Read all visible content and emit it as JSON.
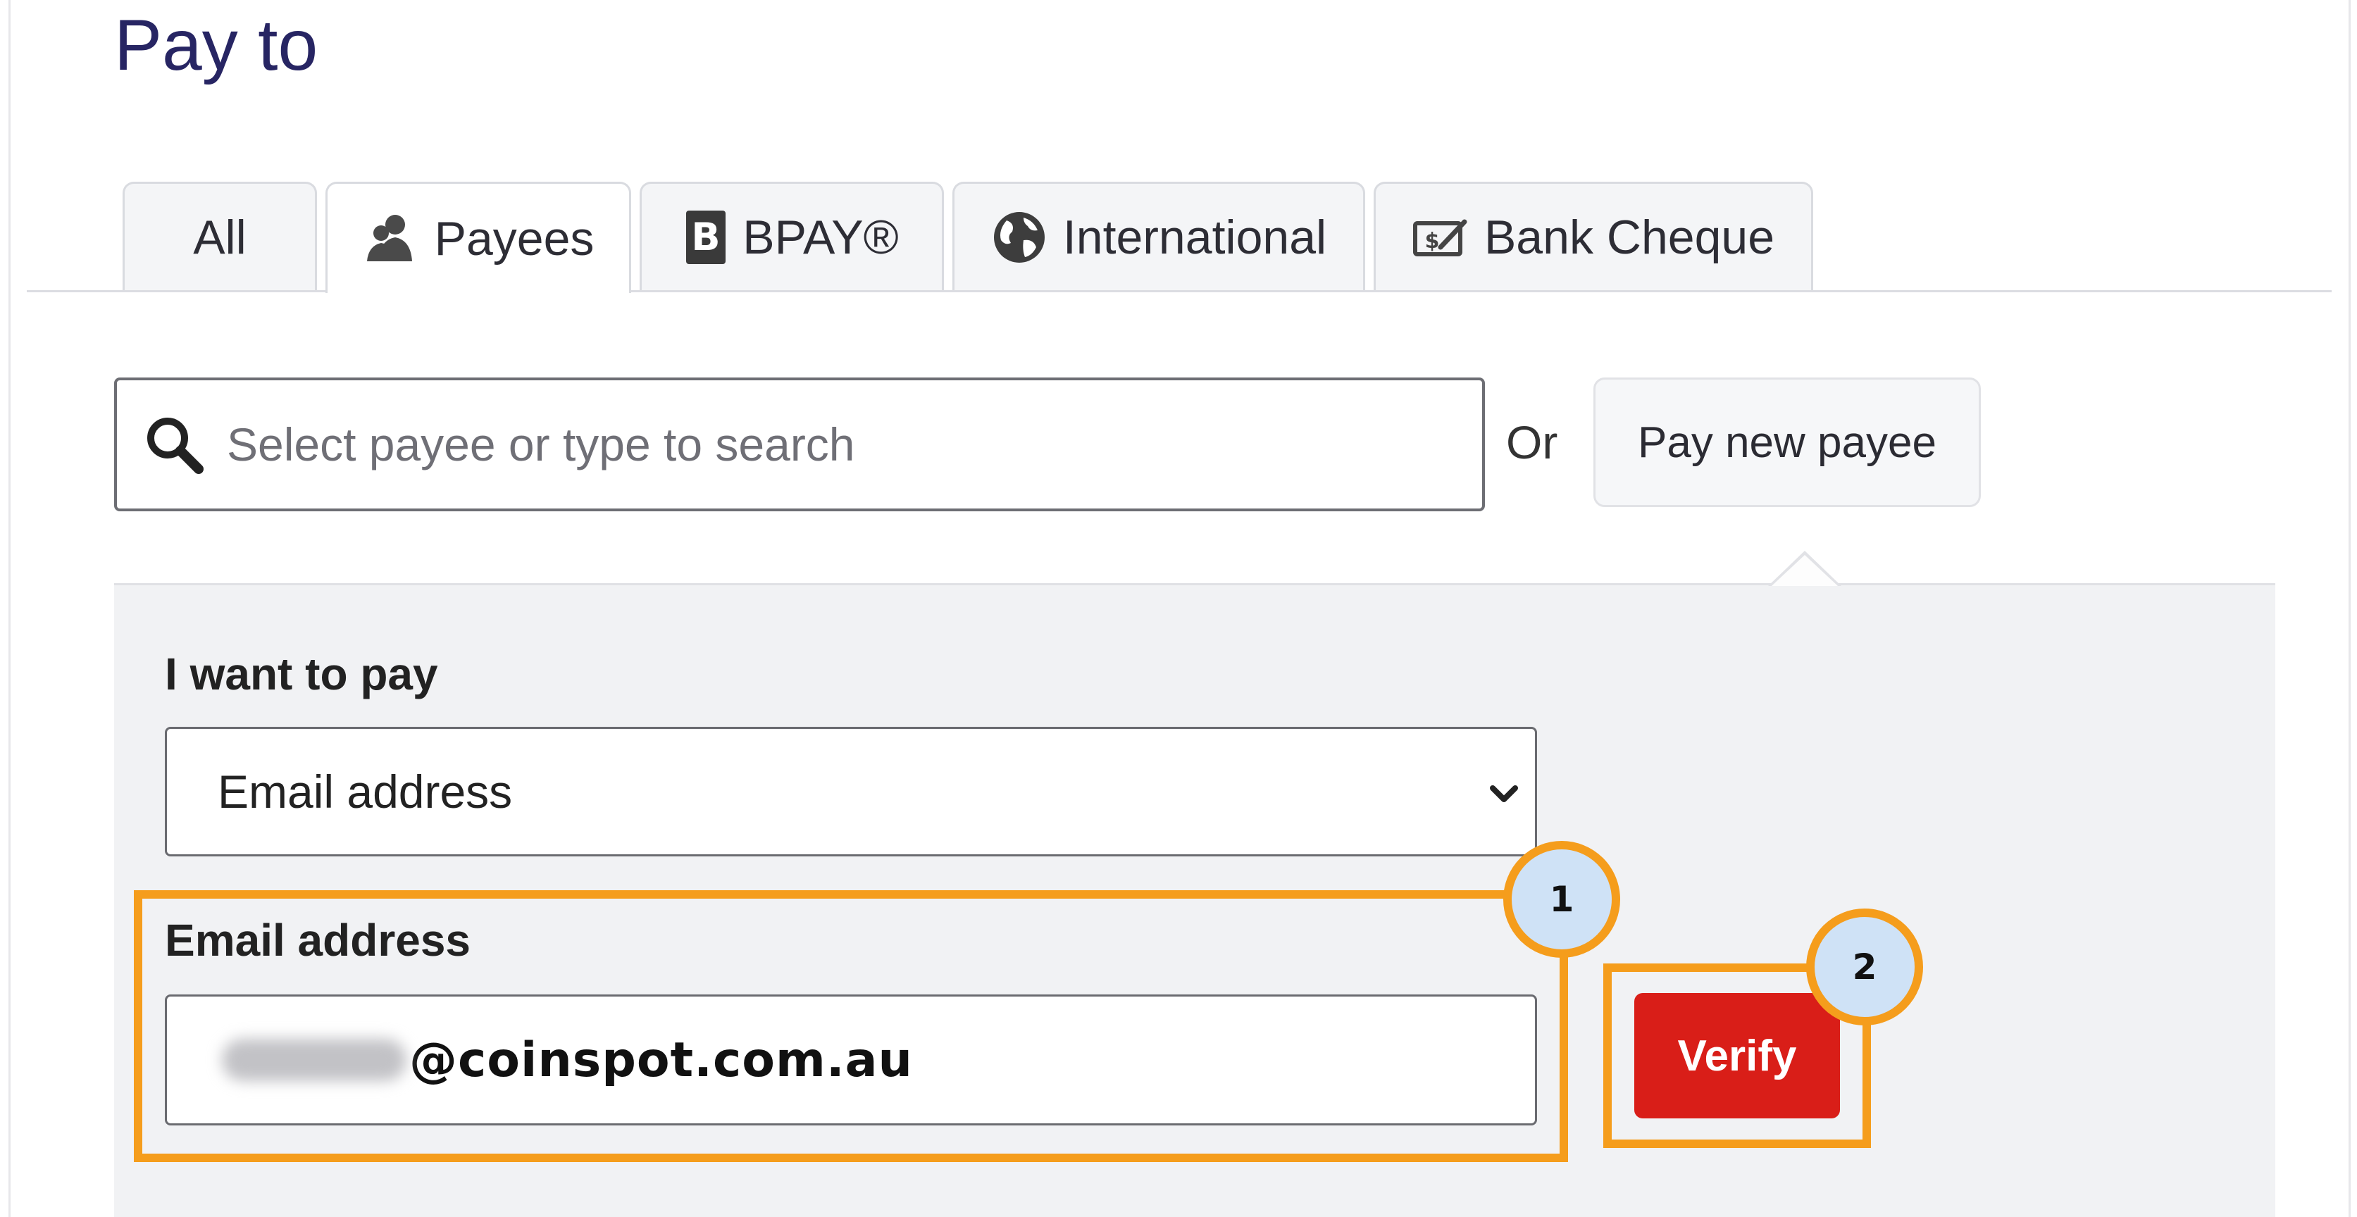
{
  "page": {
    "title": "Pay to"
  },
  "tabs": [
    {
      "label": "All",
      "icon": "none",
      "active": false
    },
    {
      "label": "Payees",
      "icon": "payees-icon",
      "active": true
    },
    {
      "label": "BPAY®",
      "icon": "bpay-icon",
      "active": false
    },
    {
      "label": "International",
      "icon": "globe-icon",
      "active": false
    },
    {
      "label": "Bank Cheque",
      "icon": "cheque-icon",
      "active": false
    }
  ],
  "search": {
    "placeholder": "Select payee or type to search",
    "value": ""
  },
  "or_label": "Or",
  "pay_new_payee": {
    "label": "Pay new payee"
  },
  "pay_form": {
    "want_label": "I want to pay",
    "type_select": {
      "value": "Email address"
    },
    "email_label": "Email address",
    "email_value_visible": "@coinspot.com.au",
    "verify_label": "Verify"
  },
  "annotations": [
    {
      "number": "1"
    },
    {
      "number": "2"
    }
  ],
  "colors": {
    "title": "#272563",
    "verify_button": "#d91e18",
    "highlight": "#f59d1c",
    "badge_fill": "#cfe2f6",
    "panel": "#f1f2f4"
  }
}
